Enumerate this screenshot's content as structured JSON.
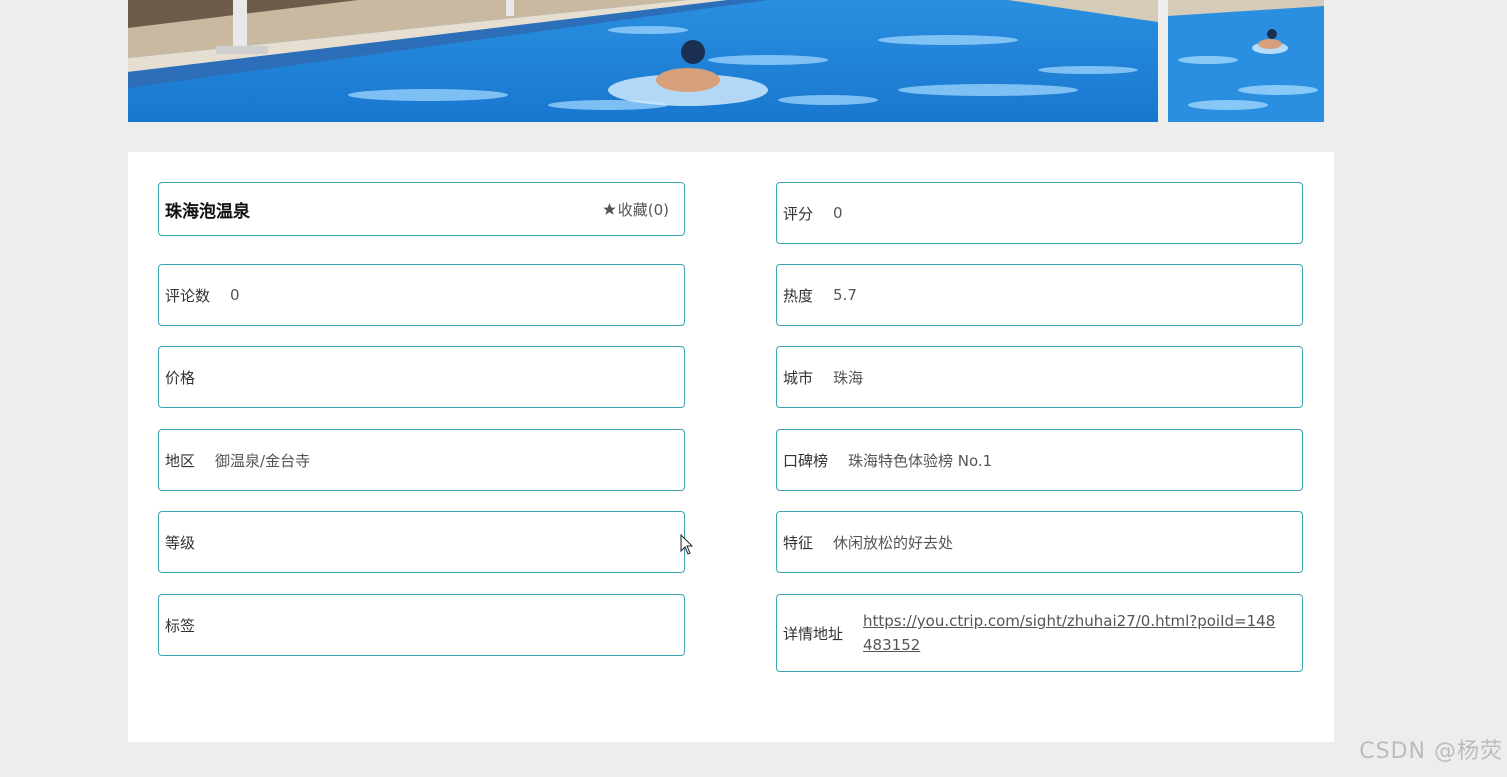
{
  "spot": {
    "name": "珠海泡温泉",
    "favorite_label": "收藏(0)"
  },
  "fields_left": [
    {
      "label": "评论数",
      "value": "0"
    },
    {
      "label": "价格",
      "value": ""
    },
    {
      "label": "地区",
      "value": "御温泉/金台寺"
    },
    {
      "label": "等级",
      "value": ""
    },
    {
      "label": "标签",
      "value": ""
    }
  ],
  "fields_right": [
    {
      "label": "评分",
      "value": "0"
    },
    {
      "label": "热度",
      "value": "5.7"
    },
    {
      "label": "城市",
      "value": "珠海"
    },
    {
      "label": "口碑榜",
      "value": "珠海特色体验榜 No.1"
    },
    {
      "label": "特征",
      "value": "休闲放松的好去处"
    },
    {
      "label": "详情地址",
      "value": "https://you.ctrip.com/sight/zhuhai27/0.html?poiId=148483152"
    }
  ],
  "watermark": "CSDN @杨荧",
  "colors": {
    "border": "#3aa5b0",
    "background": "#ededee",
    "pool": "#1a7fd0"
  },
  "icons": {
    "favorite": "star-icon",
    "cursor": "mouse-cursor-icon"
  }
}
